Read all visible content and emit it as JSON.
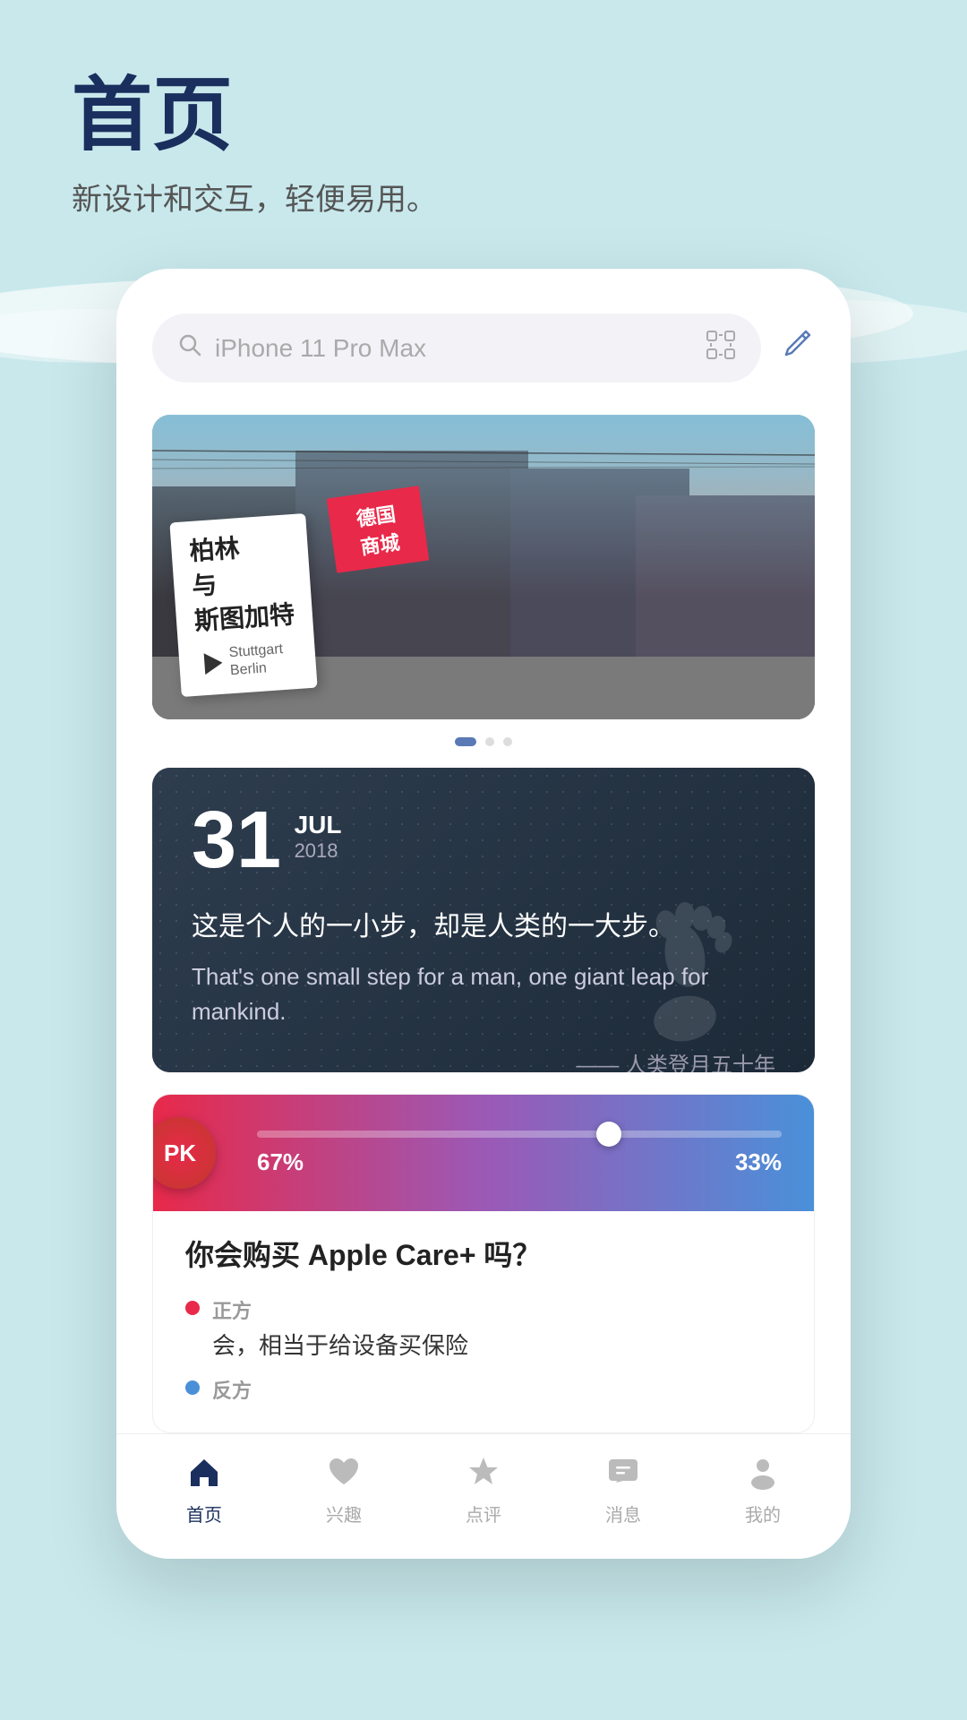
{
  "header": {
    "title": "首页",
    "subtitle": "新设计和交互，轻便易用。"
  },
  "search": {
    "placeholder": "iPhone 11 Pro Max",
    "search_icon": "search-icon",
    "scan_icon": "scan-icon",
    "edit_icon": "edit-icon"
  },
  "banner": {
    "berlin_card_line1": "柏林",
    "berlin_card_line2": "与",
    "berlin_card_line3": "斯图加特",
    "red_label_line1": "德国",
    "red_label_line2": "商城",
    "sub_label": "Stuttgart\nBerlin"
  },
  "carousel_dots": [
    "active",
    "inactive",
    "inactive"
  ],
  "date_card": {
    "day": "31",
    "month": "JUL",
    "year": "2018",
    "quote_zh": "这是个人的一小步，却是人类的一大步。",
    "quote_en": "That's one small step for a man, one\ngiant leap for mankind.",
    "source": "—— 人类登月五十年"
  },
  "pk_card": {
    "badge": "PK",
    "left_pct": "67%",
    "right_pct": "33%",
    "question": "你会购买 Apple Care+ 吗？",
    "option1_label": "正方",
    "option1_text": "会，相当于给设备买保险",
    "option2_label": "反方",
    "option2_text": ""
  },
  "tabs": [
    {
      "label": "首页",
      "icon": "home-icon",
      "active": true
    },
    {
      "label": "兴趣",
      "icon": "heart-icon",
      "active": false
    },
    {
      "label": "点评",
      "icon": "star-icon",
      "active": false
    },
    {
      "label": "消息",
      "icon": "message-icon",
      "active": false
    },
    {
      "label": "我的",
      "icon": "user-icon",
      "active": false
    }
  ],
  "colors": {
    "background": "#c8e8ec",
    "title": "#1a2f5e",
    "accent_blue": "#4a90d9",
    "accent_red": "#e8294a",
    "tab_active": "#1a2f5e",
    "tab_inactive": "#bbb"
  }
}
